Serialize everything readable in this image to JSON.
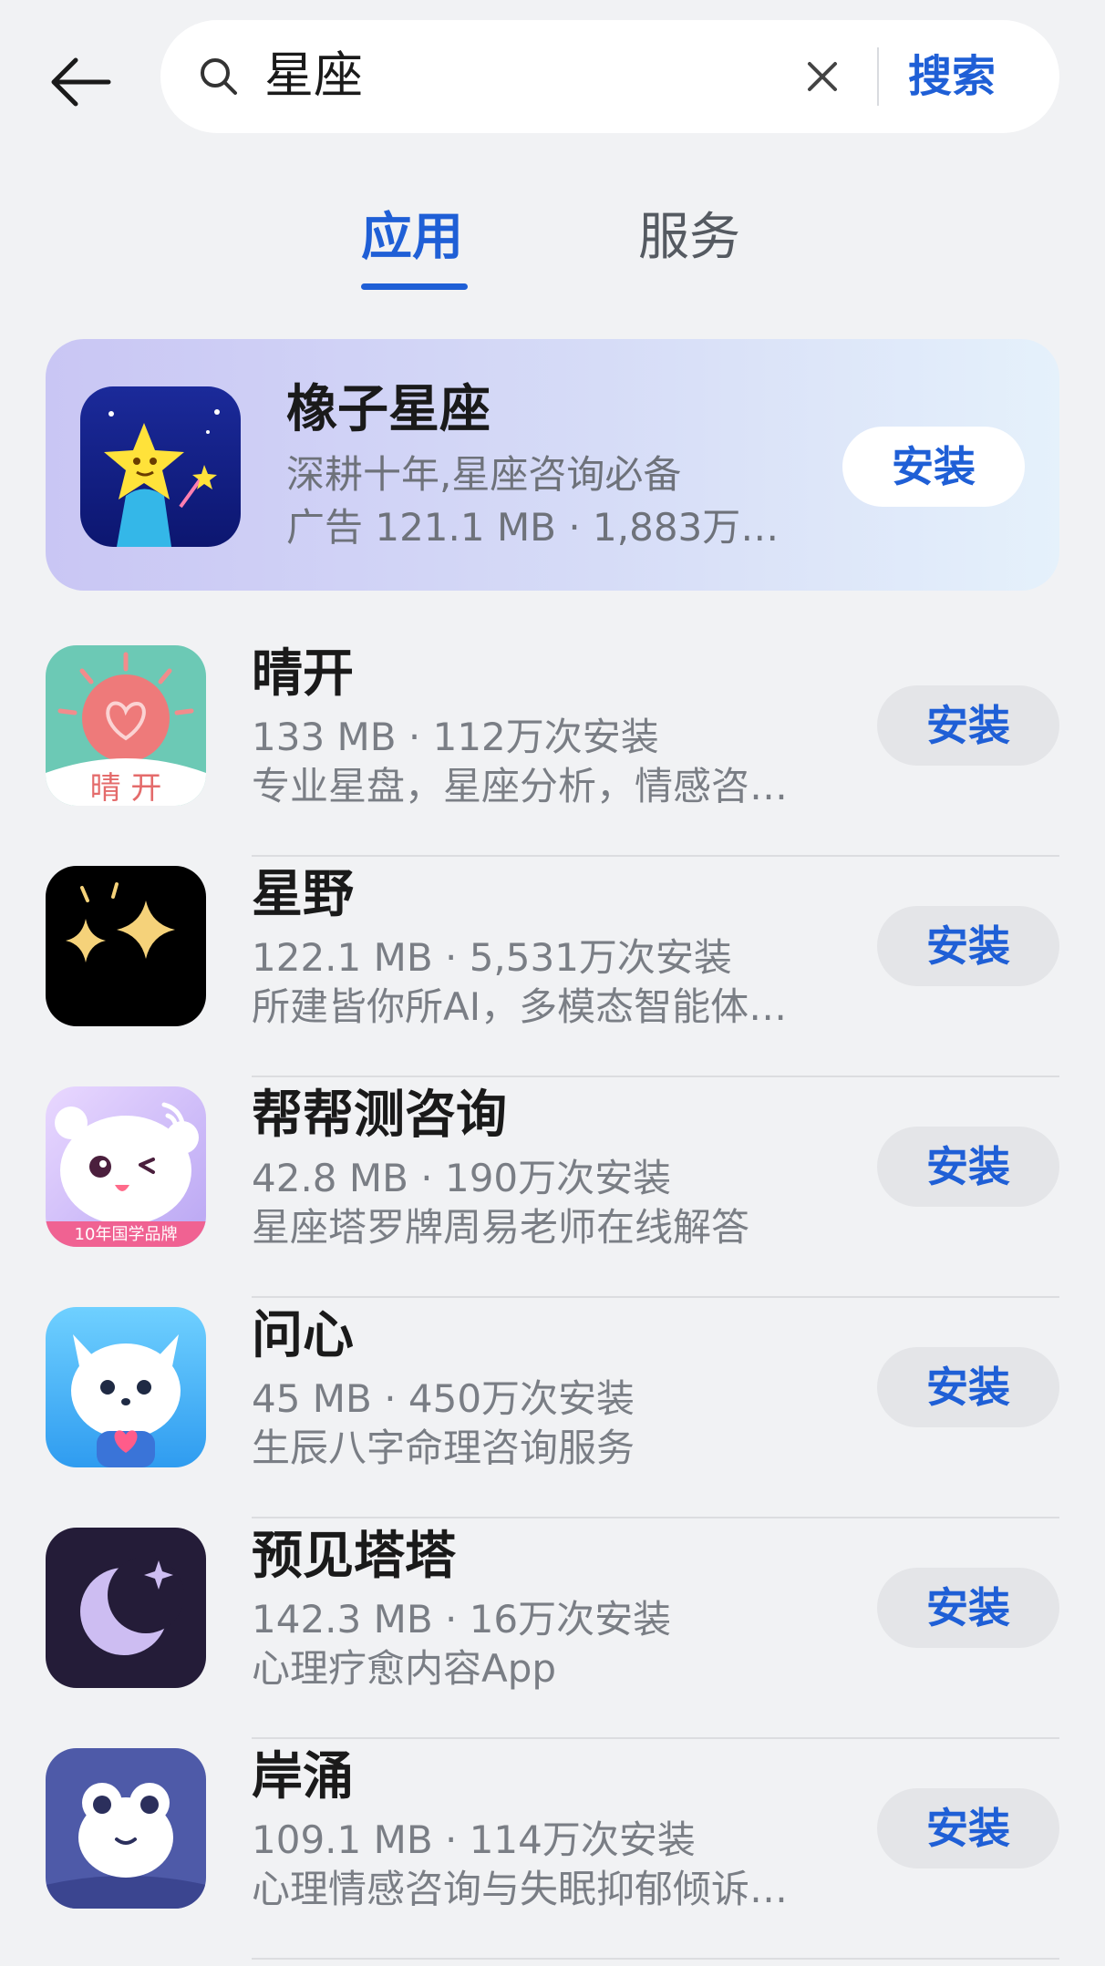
{
  "search": {
    "query": "星座",
    "button_label": "搜索"
  },
  "tabs": [
    {
      "label": "应用",
      "active": true
    },
    {
      "label": "服务",
      "active": false
    }
  ],
  "ad": {
    "name": "橡子星座",
    "desc": "深耕十年,星座咨询必备",
    "meta": "广告 121.1 MB · 1,883万…",
    "install_label": "安装"
  },
  "apps": [
    {
      "name": "晴开",
      "meta": "133 MB · 112万次安装",
      "desc": "专业星盘，星座分析，情感咨…",
      "install_label": "安装",
      "icon": "qingkai-app-icon"
    },
    {
      "name": "星野",
      "meta": "122.1 MB · 5,531万次安装",
      "desc": "所建皆你所AI，多模态智能体…",
      "install_label": "安装",
      "icon": "xingye-app-icon"
    },
    {
      "name": "帮帮测咨询",
      "meta": "42.8 MB · 190万次安装",
      "desc": "星座塔罗牌周易老师在线解答",
      "install_label": "安装",
      "icon": "bangbangce-app-icon",
      "icon_badge": "10年国学品牌"
    },
    {
      "name": "问心",
      "meta": "45 MB · 450万次安装",
      "desc": "生辰八字命理咨询服务",
      "install_label": "安装",
      "icon": "wenxin-app-icon"
    },
    {
      "name": "预见塔塔",
      "meta": "142.3 MB · 16万次安装",
      "desc": "心理疗愈内容App",
      "install_label": "安装",
      "icon": "yujiantata-app-icon"
    },
    {
      "name": "岸涌",
      "meta": "109.1 MB · 114万次安装",
      "desc": "心理情感咨询与失眠抑郁倾诉…",
      "install_label": "安装",
      "icon": "anyong-app-icon"
    }
  ],
  "colors": {
    "accent": "#1f5fd6",
    "background": "#f1f2f4",
    "secondary_text": "#7a7e85"
  }
}
